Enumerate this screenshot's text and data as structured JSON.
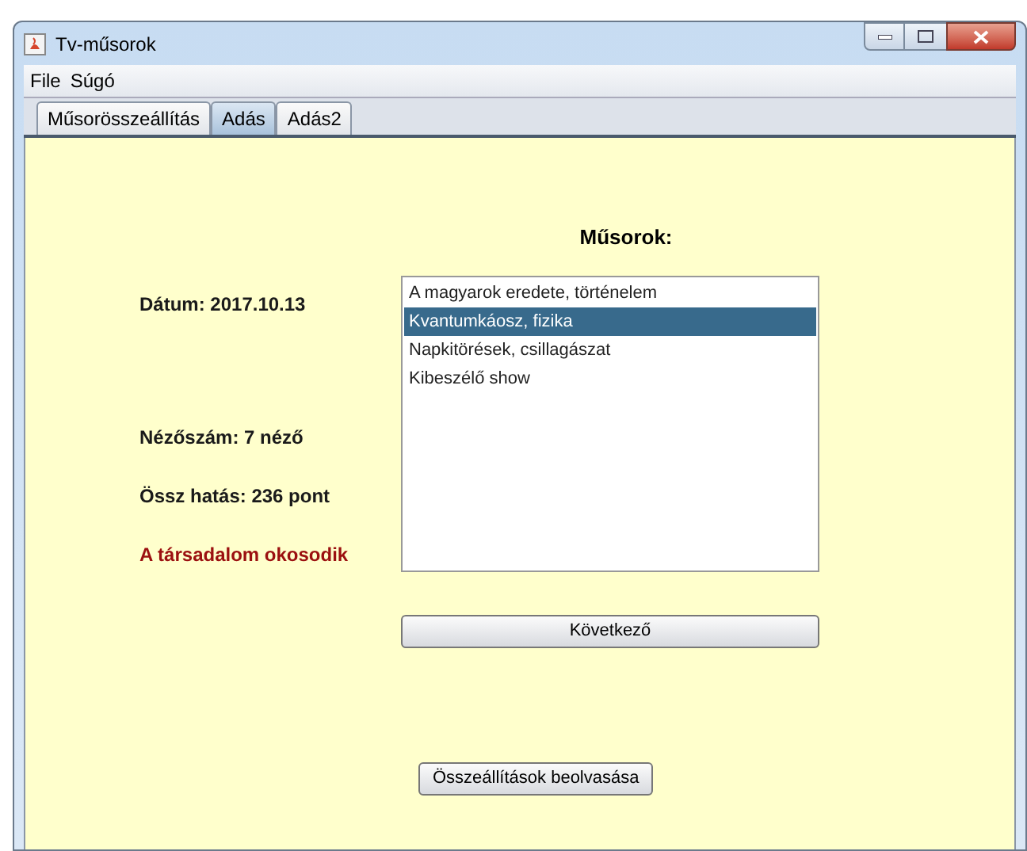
{
  "window": {
    "title": "Tv-műsorok"
  },
  "menu": [
    "File",
    "Súgó"
  ],
  "tabs": [
    {
      "label": "Műsorösszeállítás",
      "selected": false
    },
    {
      "label": "Adás",
      "selected": true
    },
    {
      "label": "Adás2",
      "selected": false
    }
  ],
  "info": [
    {
      "kind": "plain",
      "text": "Dátum: 2017.10.13"
    },
    {
      "kind": "plain",
      "text": "Nézőszám: 7 néző"
    },
    {
      "kind": "plain",
      "text": "Össz hatás: 236 pont"
    },
    {
      "kind": "alert",
      "text": "A társadalom okosodik"
    }
  ],
  "list": {
    "title": "Műsorok:",
    "items": [
      {
        "label": "A magyarok eredete, történelem",
        "selected": false
      },
      {
        "label": "Kvantumkáosz, fizika",
        "selected": true
      },
      {
        "label": "Napkitörések, csillagászat",
        "selected": false
      },
      {
        "label": "Kibeszélő show",
        "selected": false
      }
    ]
  },
  "next_button": "Következő",
  "load_button": "Összeállítások beolvasása"
}
